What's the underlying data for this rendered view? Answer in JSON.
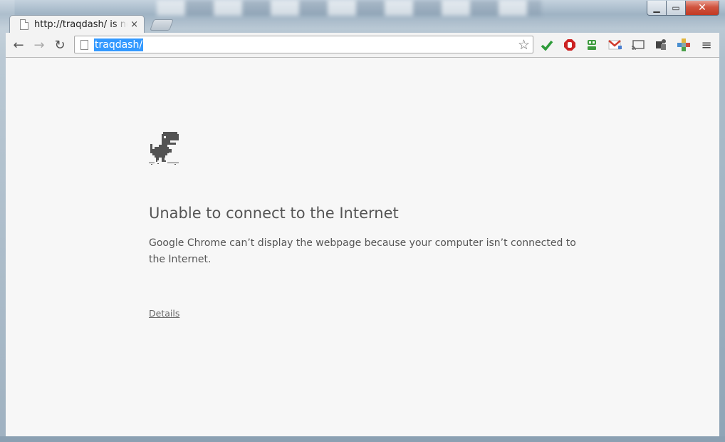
{
  "window": {
    "minimize_glyph": "▁",
    "maximize_glyph": "▭",
    "close_glyph": "✕"
  },
  "tab": {
    "title": "http://traqdash/ is not available",
    "close_glyph": "×"
  },
  "toolbar": {
    "back_glyph": "←",
    "forward_glyph": "→",
    "reload_glyph": "↻",
    "url": "traqdash/",
    "star_glyph": "☆",
    "menu_glyph": "≡",
    "extensions": [
      {
        "name": "checkmark-icon",
        "color": "#2e9b3a"
      },
      {
        "name": "stop-sign-icon",
        "color": "#cc2222"
      },
      {
        "name": "robot-icon",
        "color": "#3c9a3c"
      },
      {
        "name": "gmail-icon",
        "color": "#d03a2b"
      },
      {
        "name": "cast-icon",
        "color": "#666666"
      },
      {
        "name": "extension-dark-icon",
        "color": "#444444"
      },
      {
        "name": "puzzle-icon",
        "color": "#4a8fd0"
      }
    ]
  },
  "content": {
    "headline": "Unable to connect to the Internet",
    "body": "Google Chrome can’t display the webpage because your computer isn’t connected to the Internet.",
    "details_link": "Details"
  },
  "colors": {
    "selection": "#3399ff",
    "page_background": "#f7f7f7",
    "text": "#555555"
  }
}
